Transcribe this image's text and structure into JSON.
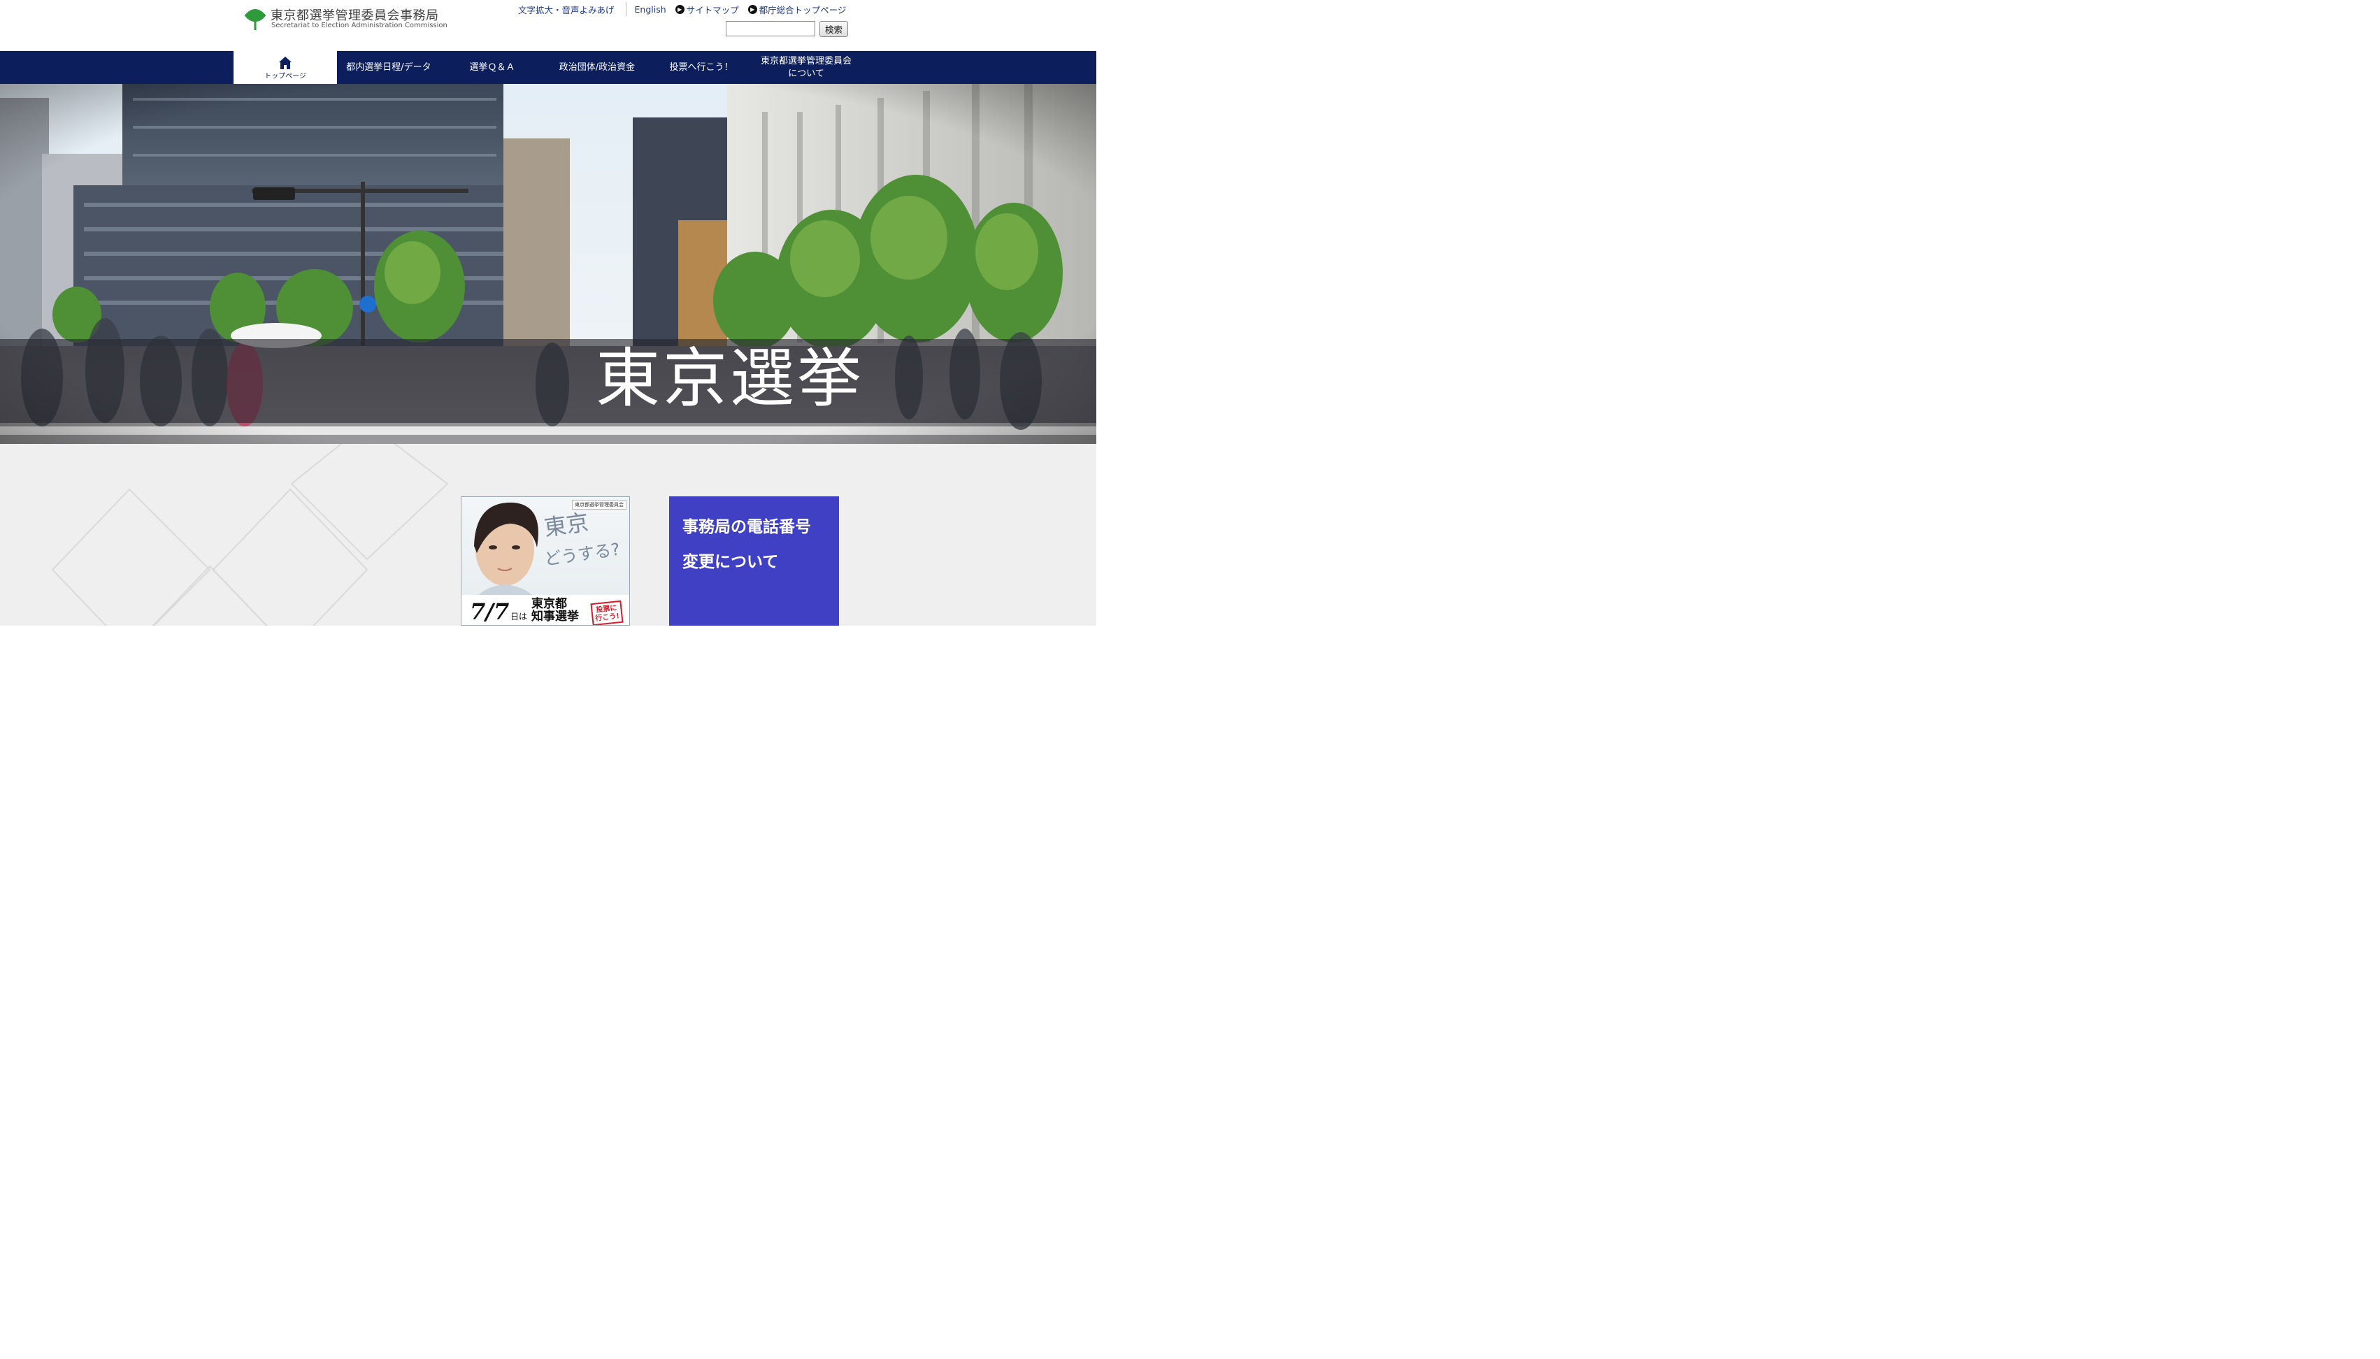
{
  "header": {
    "logo_jp": "東京都選挙管理委員会事務局",
    "logo_en": "Secretariat to Election Administration Commission",
    "util_links": {
      "accessibility": "文字拡大・音声よみあげ",
      "english": "English",
      "sitemap": "サイトマップ",
      "metro_top": "都庁総合トップページ"
    },
    "search": {
      "value": "",
      "button_label": "検索"
    }
  },
  "nav": {
    "home_label": "トップページ",
    "items": [
      "都内選挙日程/データ",
      "選挙Ｑ＆Ａ",
      "政治団体/政治資金",
      "投票へ行こう！",
      "東京都選挙管理委員会について"
    ],
    "item5_line1": "東京都選挙管理委員会",
    "item5_line2": "について"
  },
  "hero": {
    "title": "東京選挙"
  },
  "banners": {
    "election": {
      "issuer": "東京都選挙管理委員会",
      "catch1": "東京",
      "catch2": "どうする?",
      "date": "7/7",
      "date_suffix": "日は",
      "election_line1": "東京都",
      "election_line2": "知事選挙",
      "stamp_line1": "投票に",
      "stamp_line2": "行こう!"
    },
    "phone_notice": {
      "line1": "事務局の電話番号",
      "line2": "変更について"
    }
  },
  "colors": {
    "nav_bg": "#0c1e5b",
    "link": "#1e3a8a",
    "phone_banner_bg": "#4040c5",
    "logo_green": "#2e9a3c",
    "content_bg": "#efefef"
  }
}
